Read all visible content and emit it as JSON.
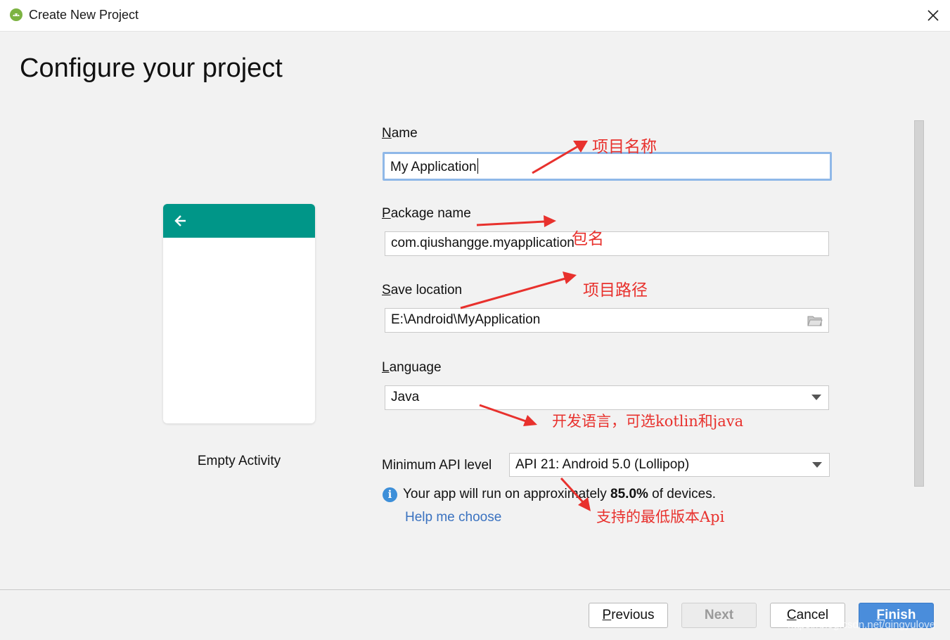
{
  "window": {
    "title": "Create New Project",
    "close_icon": "close-icon",
    "app_icon": "android-studio-icon"
  },
  "page": {
    "heading": "Configure your project"
  },
  "preview": {
    "caption": "Empty Activity",
    "bar_color": "#009688",
    "back_icon": "arrow-left-icon"
  },
  "form": {
    "name": {
      "label_mnemonic": "N",
      "label_rest": "ame",
      "value": "My Application"
    },
    "package": {
      "label_mnemonic": "P",
      "label_rest": "ackage name",
      "value": "com.qiushangge.myapplication"
    },
    "save_location": {
      "label_mnemonic": "S",
      "label_rest": "ave location",
      "value": "E:\\Android\\MyApplication",
      "browse_icon": "folder-icon"
    },
    "language": {
      "label_mnemonic": "L",
      "label_rest": "anguage",
      "value": "Java"
    },
    "min_api": {
      "label": "Minimum API level",
      "value": "API 21: Android 5.0 (Lollipop)"
    },
    "info": {
      "prefix": "Your app will run on approximately ",
      "percent": "85.0%",
      "suffix": " of devices.",
      "icon": "info-icon"
    },
    "help_link": "Help me choose"
  },
  "buttons": {
    "previous": {
      "mnemonic": "P",
      "rest": "revious"
    },
    "next": "Next",
    "cancel": {
      "mnemonic": "C",
      "rest": "ancel"
    },
    "finish": {
      "mnemonic": "F",
      "rest": "inish"
    }
  },
  "annotations": {
    "name": "项目名称",
    "package": "包名",
    "location": "项目路径",
    "language": "开发语言，可选kotlin和java",
    "api": "支持的最低版本Api",
    "color": "#e8312d"
  },
  "watermark": "https://blog.csdn.net/qingyulove"
}
